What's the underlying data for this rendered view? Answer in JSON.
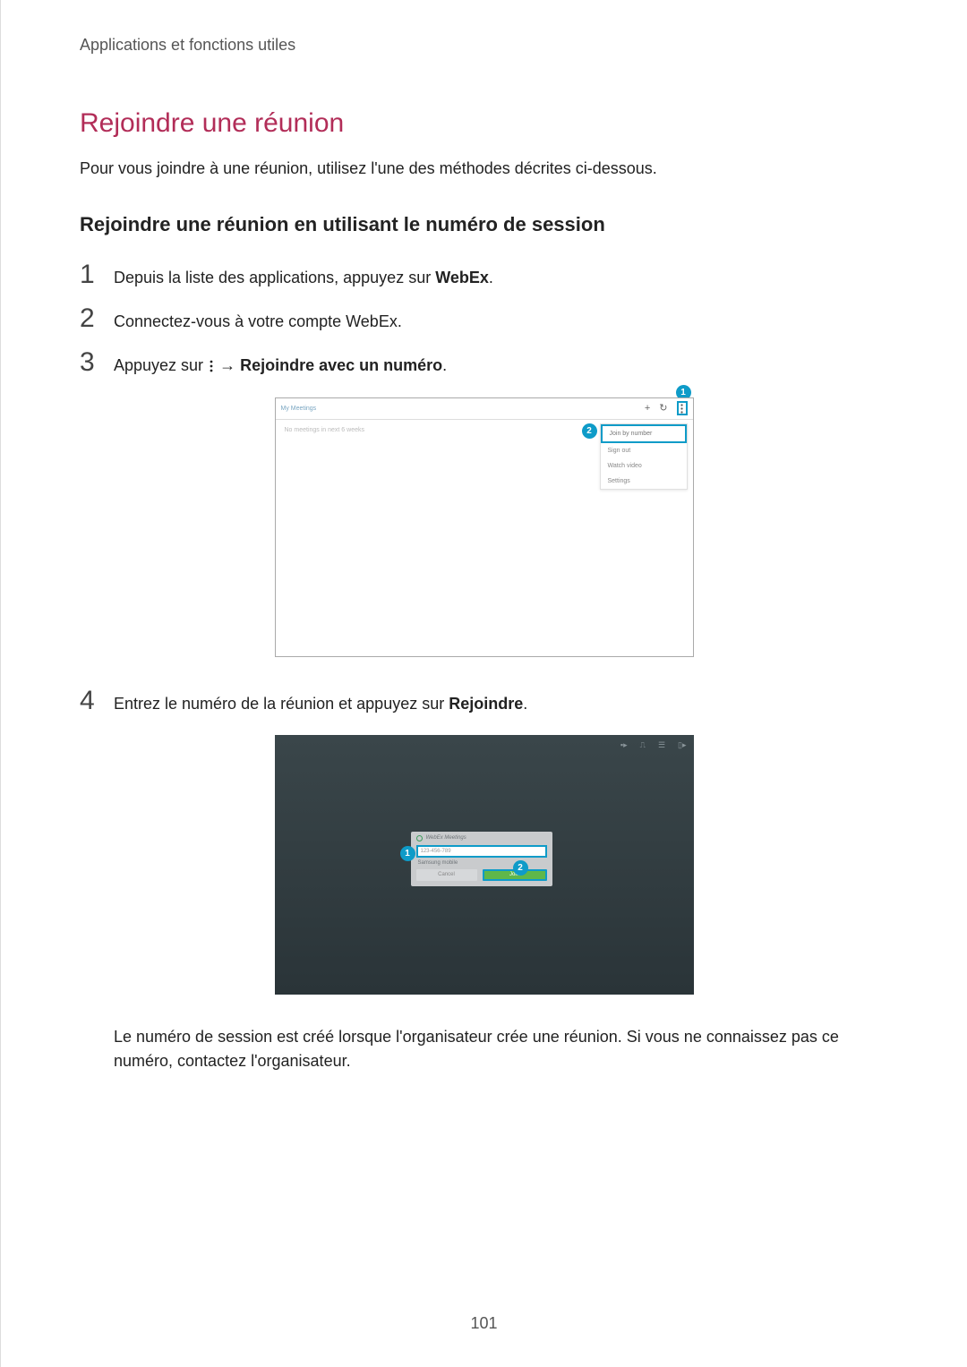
{
  "page": {
    "header": "Applications et fonctions utiles",
    "number": "101"
  },
  "section": {
    "title": "Rejoindre une réunion",
    "intro": "Pour vous joindre à une réunion, utilisez l'une des méthodes décrites ci-dessous.",
    "subtitle": "Rejoindre une réunion en utilisant le numéro de session"
  },
  "steps": {
    "s1_pre": "Depuis la liste des applications, appuyez sur ",
    "s1_bold": "WebEx",
    "s1_post": ".",
    "s2": "Connectez-vous à votre compte WebEx.",
    "s3_pre": "Appuyez sur ",
    "s3_arrow": " → ",
    "s3_bold": "Rejoindre avec un numéro",
    "s3_post": ".",
    "s4_pre": "Entrez le numéro de la réunion et appuyez sur ",
    "s4_bold": "Rejoindre",
    "s4_post": ".",
    "s4_note": "Le numéro de session est créé lorsque l'organisateur crée une réunion. Si vous ne connaissez pas ce numéro, contactez l'organisateur.",
    "n1": "1",
    "n2": "2",
    "n3": "3",
    "n4": "4"
  },
  "shot1": {
    "title": "My Meetings",
    "empty": "No meetings in next 6 weeks",
    "menu": [
      "Join by number",
      "Sign out",
      "Watch video",
      "Settings"
    ],
    "callout1": "1",
    "callout2": "2"
  },
  "shot2": {
    "dialogTitle": "WebEx Meetings",
    "inputPlaceholder": "123-456-789",
    "account": "Samsung mobile",
    "cancel": "Cancel",
    "join": "Join",
    "callout1": "1",
    "callout2": "2"
  }
}
